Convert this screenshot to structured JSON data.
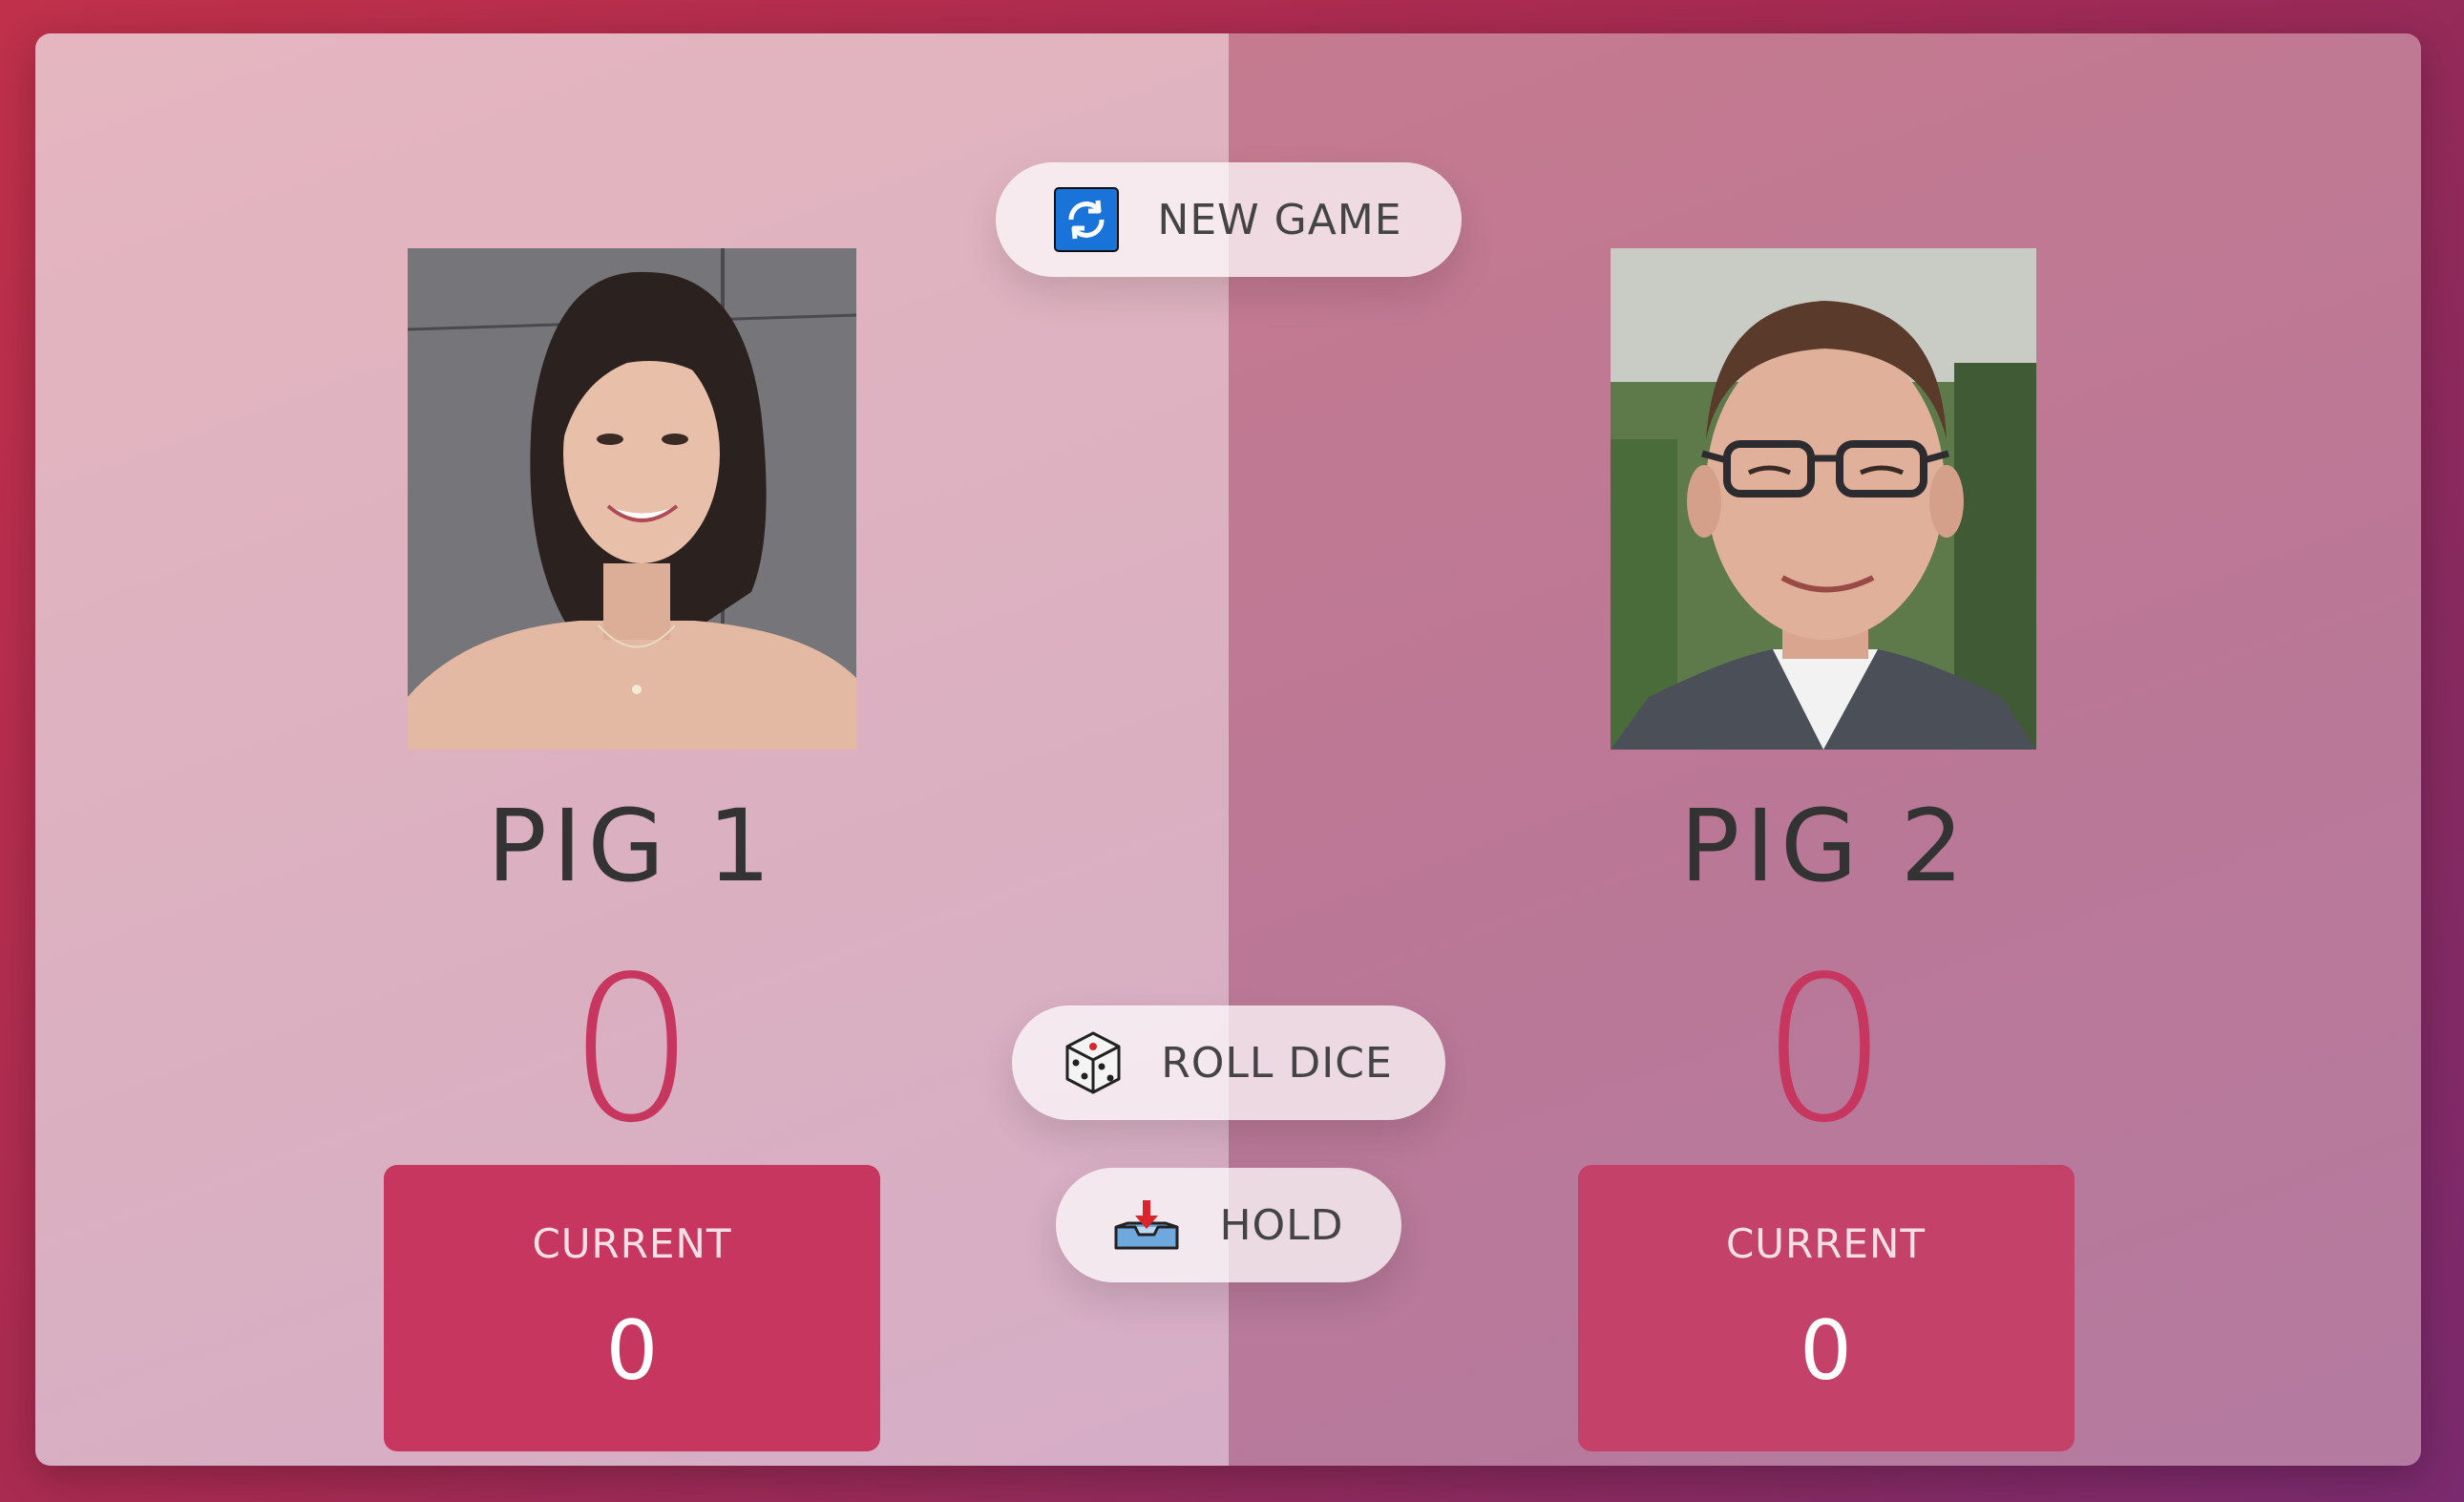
{
  "players": [
    {
      "name": "PIG 1",
      "score": "0",
      "current_label": "CURRENT",
      "current_score": "0"
    },
    {
      "name": "PIG 2",
      "score": "0",
      "current_label": "CURRENT",
      "current_score": "0"
    }
  ],
  "buttons": {
    "new_game": "NEW GAME",
    "roll_dice": "ROLL DICE",
    "hold": "HOLD"
  },
  "icons": {
    "new_game": "refresh-icon",
    "roll_dice": "dice-icon",
    "hold": "inbox-tray-icon"
  },
  "colors": {
    "accent": "#c7365f",
    "active_panel": "#e5b6c0",
    "inactive_panel": "#bb7896"
  }
}
